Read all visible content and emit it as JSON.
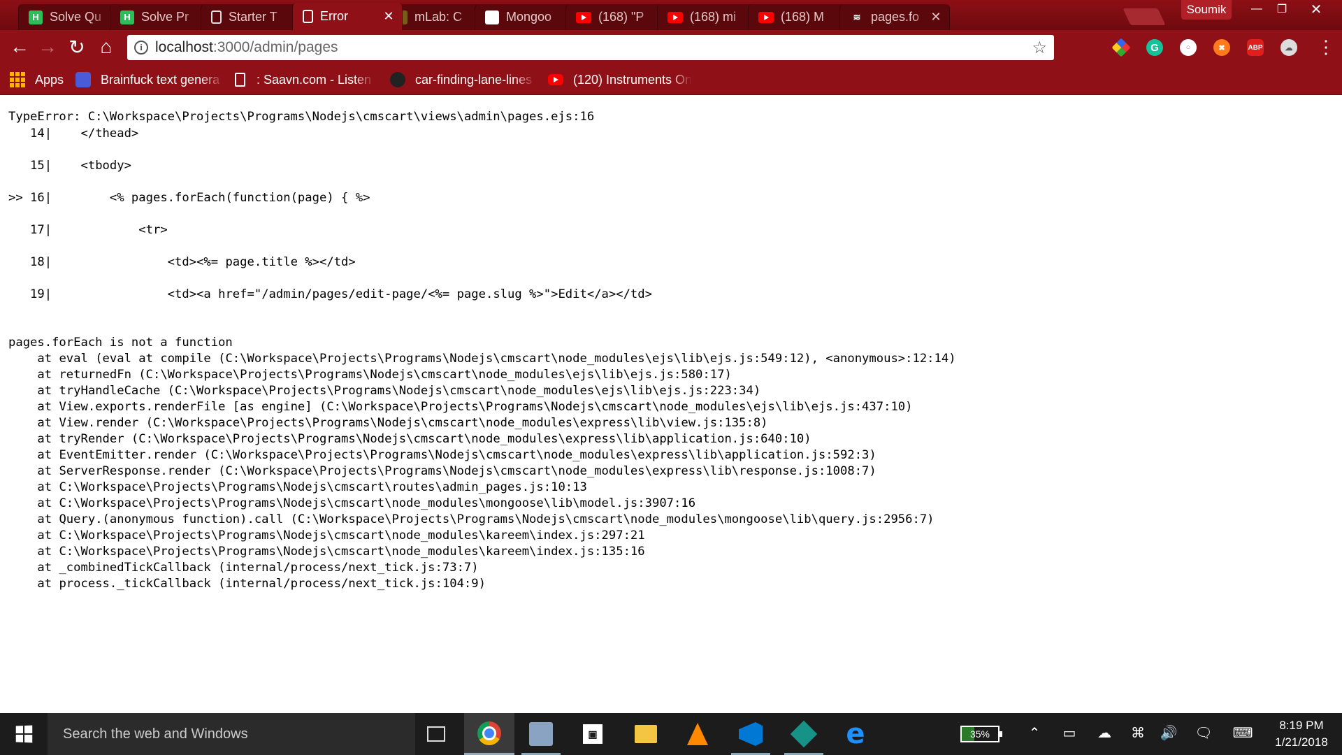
{
  "browser": {
    "tabs": [
      {
        "title": "Solve Qu",
        "icon": "hackerrank-icon",
        "active": false
      },
      {
        "title": "Solve Pr",
        "icon": "hackerrank-icon",
        "active": false
      },
      {
        "title": "Starter T",
        "icon": "document-icon",
        "active": false
      },
      {
        "title": "Error",
        "icon": "document-icon",
        "active": true
      },
      {
        "title": "mLab: C",
        "icon": "mlab-icon",
        "active": false
      },
      {
        "title": "Mongoo",
        "icon": "mongoose-icon",
        "active": false
      },
      {
        "title": "(168) \"P",
        "icon": "youtube-icon",
        "active": false
      },
      {
        "title": "(168) mi",
        "icon": "youtube-icon",
        "active": false
      },
      {
        "title": "(168) M",
        "icon": "youtube-icon",
        "active": false
      },
      {
        "title": "pages.fo",
        "icon": "stackoverflow-icon",
        "active": false
      }
    ],
    "profile_name": "Soumik",
    "url": {
      "host": "localhost",
      "path": ":3000/admin/pages"
    },
    "bookmarks": [
      {
        "label": "Apps",
        "icon": "apps-grid-icon"
      },
      {
        "label": "Brainfuck text genera",
        "icon": "brainfuck-icon"
      },
      {
        "label": ": Saavn.com - Listen t",
        "icon": "document-icon"
      },
      {
        "label": "car-finding-lane-lines",
        "icon": "github-icon"
      },
      {
        "label": "(120) Instruments On",
        "icon": "youtube-icon"
      }
    ],
    "colors": {
      "theme": "#8f1117",
      "tabstrip": "#6e0a0e"
    }
  },
  "error": {
    "header": "TypeError: C:\\Workspace\\Projects\\Programs\\Nodejs\\cmscart\\views\\admin\\pages.ejs:16",
    "source_lines": [
      {
        "marker": "   ",
        "number": "14",
        "code": "    </thead>"
      },
      {
        "marker": "   ",
        "number": "15",
        "code": "    <tbody>"
      },
      {
        "marker": ">> ",
        "number": "16",
        "code": "        <% pages.forEach(function(page) { %>"
      },
      {
        "marker": "   ",
        "number": "17",
        "code": "            <tr>"
      },
      {
        "marker": "   ",
        "number": "18",
        "code": "                <td><%= page.title %></td>"
      },
      {
        "marker": "   ",
        "number": "19",
        "code": "                <td><a href=\"/admin/pages/edit-page/<%= page.slug %>\">Edit</a></td>"
      }
    ],
    "message": "pages.forEach is not a function",
    "stack": [
      "at eval (eval at compile (C:\\Workspace\\Projects\\Programs\\Nodejs\\cmscart\\node_modules\\ejs\\lib\\ejs.js:549:12), <anonymous>:12:14)",
      "at returnedFn (C:\\Workspace\\Projects\\Programs\\Nodejs\\cmscart\\node_modules\\ejs\\lib\\ejs.js:580:17)",
      "at tryHandleCache (C:\\Workspace\\Projects\\Programs\\Nodejs\\cmscart\\node_modules\\ejs\\lib\\ejs.js:223:34)",
      "at View.exports.renderFile [as engine] (C:\\Workspace\\Projects\\Programs\\Nodejs\\cmscart\\node_modules\\ejs\\lib\\ejs.js:437:10)",
      "at View.render (C:\\Workspace\\Projects\\Programs\\Nodejs\\cmscart\\node_modules\\express\\lib\\view.js:135:8)",
      "at tryRender (C:\\Workspace\\Projects\\Programs\\Nodejs\\cmscart\\node_modules\\express\\lib\\application.js:640:10)",
      "at EventEmitter.render (C:\\Workspace\\Projects\\Programs\\Nodejs\\cmscart\\node_modules\\express\\lib\\application.js:592:3)",
      "at ServerResponse.render (C:\\Workspace\\Projects\\Programs\\Nodejs\\cmscart\\node_modules\\express\\lib\\response.js:1008:7)",
      "at C:\\Workspace\\Projects\\Programs\\Nodejs\\cmscart\\routes\\admin_pages.js:10:13",
      "at C:\\Workspace\\Projects\\Programs\\Nodejs\\cmscart\\node_modules\\mongoose\\lib\\model.js:3907:16",
      "at Query.(anonymous function).call (C:\\Workspace\\Projects\\Programs\\Nodejs\\cmscart\\node_modules\\mongoose\\lib\\query.js:2956:7)",
      "at C:\\Workspace\\Projects\\Programs\\Nodejs\\cmscart\\node_modules\\kareem\\index.js:297:21",
      "at C:\\Workspace\\Projects\\Programs\\Nodejs\\cmscart\\node_modules\\kareem\\index.js:135:16",
      "at _combinedTickCallback (internal/process/next_tick.js:73:7)",
      "at process._tickCallback (internal/process/next_tick.js:104:9)"
    ]
  },
  "taskbar": {
    "search_placeholder": "Search the web and Windows",
    "apps": [
      "task-view-icon",
      "chrome-icon",
      "app-icon",
      "store-icon",
      "file-explorer-icon",
      "vlc-icon",
      "vscode-icon",
      "gitkraken-icon",
      "edge-icon"
    ],
    "battery_percent": "35%",
    "time": "8:19 PM",
    "date": "1/21/2018"
  }
}
